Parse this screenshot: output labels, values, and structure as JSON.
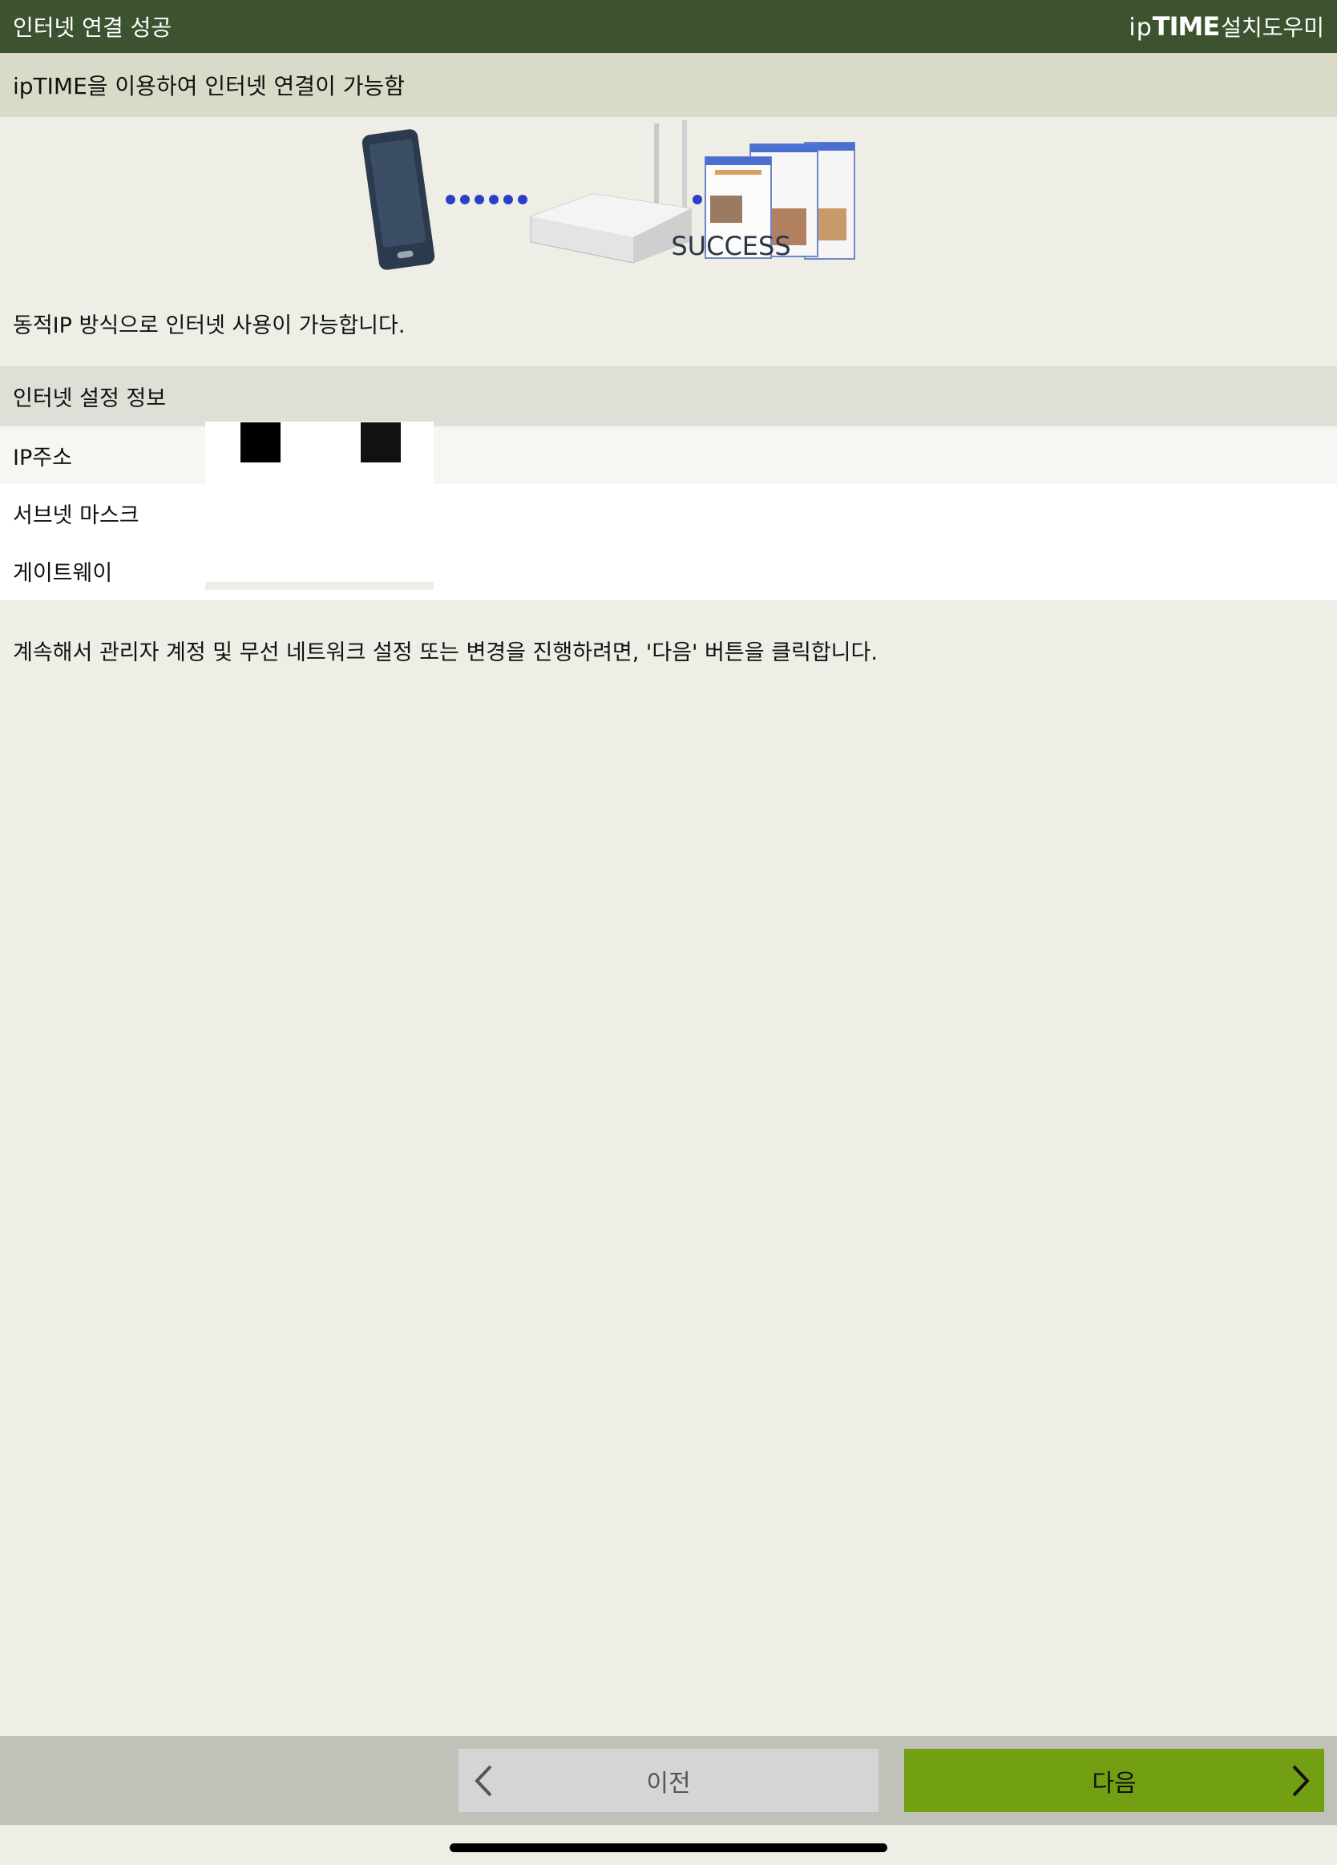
{
  "header": {
    "title": "인터넷 연결 성공",
    "brand_ip": "ip",
    "brand_time": "TIME",
    "brand_suffix": "설치도우미"
  },
  "subheader": {
    "text": "ipTIME을 이용하여 인터넷 연결이 가능함"
  },
  "illustration": {
    "success_label": "SUCCESS"
  },
  "status_message": "동적IP 방식으로 인터넷 사용이 가능합니다.",
  "internet_info": {
    "title": "인터넷 설정 정보",
    "rows": [
      {
        "label": "IP주소"
      },
      {
        "label": "서브넷 마스크"
      },
      {
        "label": "게이트웨이"
      }
    ]
  },
  "instruction": "계속해서 관리자 계정 및 무선 네트워크 설정 또는 변경을 진행하려면, '다음' 버튼을 클릭합니다.",
  "footer": {
    "prev_label": "이전",
    "next_label": "다음"
  },
  "colors": {
    "header_bg": "#3d5330",
    "subheader_bg": "#d9dbc8",
    "page_bg": "#eeeee6",
    "next_button": "#72a012",
    "prev_button": "#d5d5d5"
  },
  "icons": [
    "phone-icon",
    "router-icon",
    "browser-windows-icon",
    "chevron-left-icon",
    "chevron-right-icon"
  ]
}
